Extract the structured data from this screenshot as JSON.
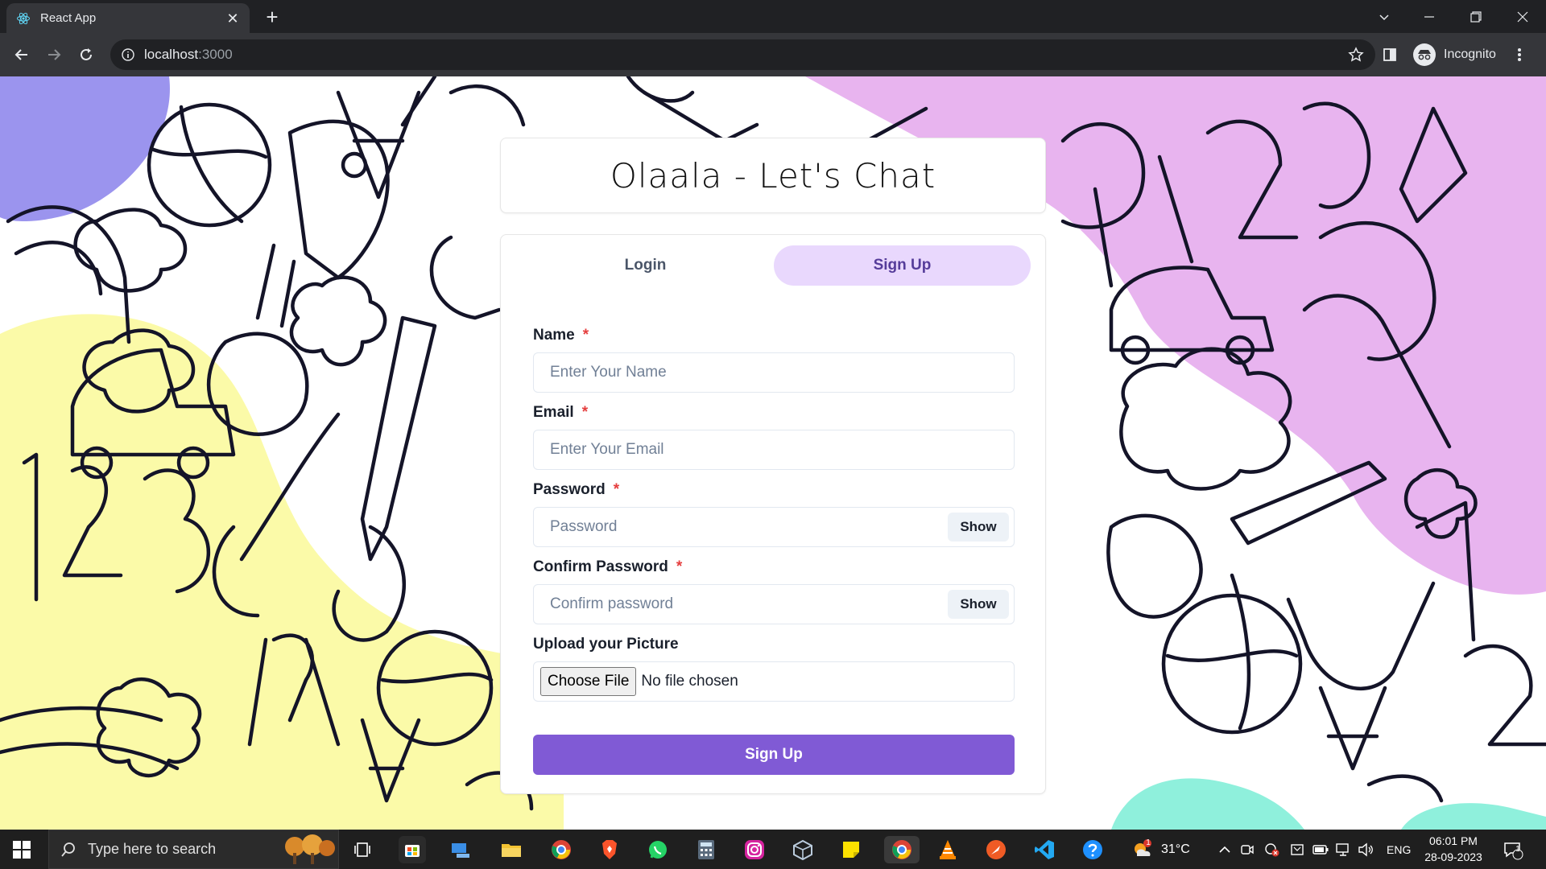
{
  "browser": {
    "tab_title": "React App",
    "url_host": "localhost",
    "url_port": ":3000",
    "profile_label": "Incognito"
  },
  "page": {
    "title": "Olaala - Let's Chat",
    "tabs": [
      {
        "label": "Login",
        "active": false
      },
      {
        "label": "Sign Up",
        "active": true
      }
    ],
    "fields": {
      "name": {
        "label": "Name",
        "required": "*",
        "placeholder": "Enter Your Name"
      },
      "email": {
        "label": "Email",
        "required": "*",
        "placeholder": "Enter Your Email"
      },
      "password": {
        "label": "Password",
        "required": "*",
        "placeholder": "Password",
        "toggle": "Show"
      },
      "confirm": {
        "label": "Confirm Password",
        "required": "*",
        "placeholder": "Confirm password",
        "toggle": "Show"
      },
      "picture": {
        "label": "Upload your Picture",
        "button": "Choose File",
        "status": "No file chosen"
      }
    },
    "submit_label": "Sign Up",
    "colors": {
      "accent": "#805ad5",
      "active_tab_bg": "#e9d8fd",
      "required": "#e53e3e"
    }
  },
  "taskbar": {
    "search_placeholder": "Type here to search",
    "weather_temp": "31°C",
    "weather_badge": "1",
    "language": "ENG",
    "time": "06:01 PM",
    "date": "28-09-2023",
    "notification_count": "1",
    "apps": [
      "task-view",
      "microsoft-store",
      "network-drive",
      "file-explorer",
      "chrome",
      "brave",
      "whatsapp",
      "calculator",
      "instagram",
      "virtualbox",
      "sticky-notes",
      "chrome-profile",
      "vlc",
      "postman",
      "vscode",
      "help"
    ]
  }
}
